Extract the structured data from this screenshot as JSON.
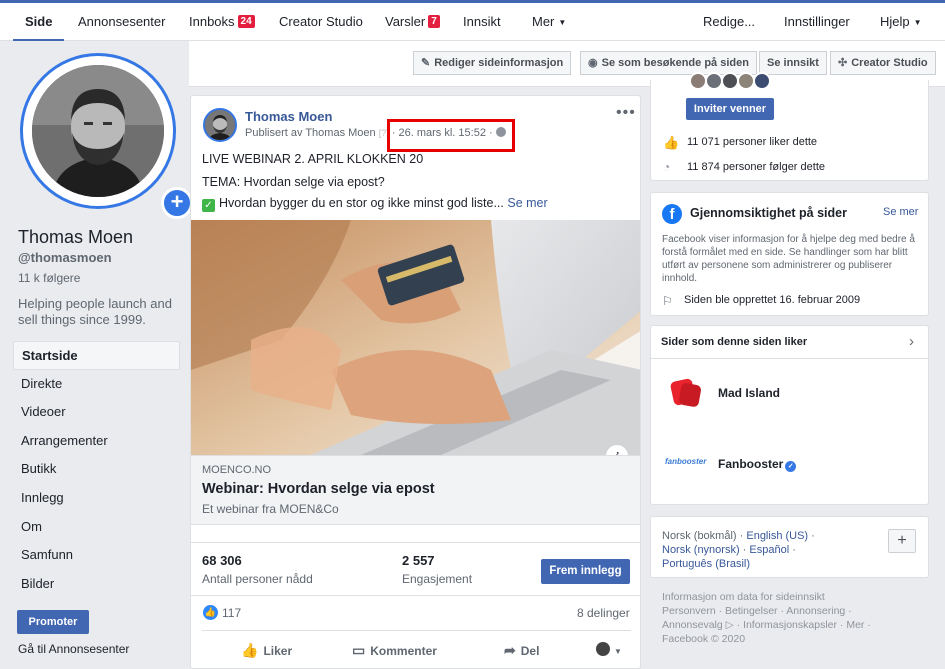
{
  "nav": {
    "items": [
      {
        "label": "Side",
        "active": true
      },
      {
        "label": "Annonsesenter"
      },
      {
        "label": "Innboks",
        "badge": "24"
      },
      {
        "label": "Creator Studio"
      },
      {
        "label": "Varsler",
        "badge": "7"
      },
      {
        "label": "Innsikt"
      },
      {
        "label": "Mer"
      }
    ],
    "right": {
      "edit": "Redige...",
      "settings": "Innstillinger",
      "help": "Hjelp"
    }
  },
  "actions": {
    "edit_info": "Rediger sideinformasjon",
    "view_as_visitor": "Se som besøkende på siden",
    "insights": "Se innsikt",
    "creator_studio": "Creator Studio"
  },
  "profile": {
    "name": "Thomas Moen",
    "username": "@thomasmoen",
    "followers": "11 k følgere",
    "bio": "Helping people launch and sell things since 1999."
  },
  "sidebar": {
    "items": [
      {
        "label": "Startside",
        "active": true
      },
      {
        "label": "Direkte"
      },
      {
        "label": "Videoer"
      },
      {
        "label": "Arrangementer"
      },
      {
        "label": "Butikk"
      },
      {
        "label": "Innlegg"
      },
      {
        "label": "Om"
      },
      {
        "label": "Samfunn"
      },
      {
        "label": "Bilder"
      }
    ],
    "promote": "Promoter",
    "ads_link": "Gå til Annonsesenter"
  },
  "post": {
    "author": "Thomas Moen",
    "published_by": "Publisert av Thomas Moen",
    "help_mark": "[?]",
    "separator": "·",
    "timestamp": "26. mars kl. 15:52",
    "line1": "LIVE WEBINAR 2. APRIL KLOKKEN 20",
    "line2": "TEMA: Hvordan selge via epost?",
    "line3": "Hvordan bygger du en stor og ikke minst god liste...",
    "see_more": "Se mer",
    "link": {
      "domain": "MOENCO.NO",
      "title": "Webinar: Hvordan selge via epost",
      "description": "Et webinar fra MOEN&Co"
    },
    "stats": {
      "reach": "68 306",
      "reach_label": "Antall personer nådd",
      "engagement": "2 557",
      "engagement_label": "Engasjement"
    },
    "boost": "Frem innlegg",
    "likes": "117",
    "shares": "8 delinger",
    "actions": {
      "like": "Liker",
      "comment": "Kommenter",
      "share": "Del"
    }
  },
  "right": {
    "invite": "Inviter venner",
    "likes_count": "11 071 personer liker dette",
    "follows_count": "11 874 personer følger dette",
    "transparency": {
      "title": "Gjennomsiktighet på sider",
      "see_more": "Se mer",
      "body": "Facebook viser informasjon for å hjelpe deg med bedre å forstå formålet med en side. Se handlinger som har blitt utført av personene som administrerer og publiserer innhold.",
      "created": "Siden ble opprettet 16. februar 2009"
    },
    "liked_pages": {
      "title": "Sider som denne siden liker",
      "pages": [
        "Mad Island",
        "Fanbooster"
      ],
      "fanbooster_logo_text": "fanbooster"
    },
    "languages": {
      "current": "Norsk (bokmål)",
      "options": [
        "English (US)",
        "Norsk (nynorsk)",
        "Español",
        "Português (Brasil)"
      ],
      "add": "+"
    },
    "footer": [
      "Informasjon om data for sideinnsikt",
      "Personvern · Betingelser · Annonsering ·",
      "Annonsevalg ▷ · Informasjonskapsler · Mer ·",
      "Facebook © 2020"
    ]
  },
  "colors": {
    "brand": "#4267b2",
    "highlight": "#e60000",
    "badge": "#e41e3f"
  }
}
